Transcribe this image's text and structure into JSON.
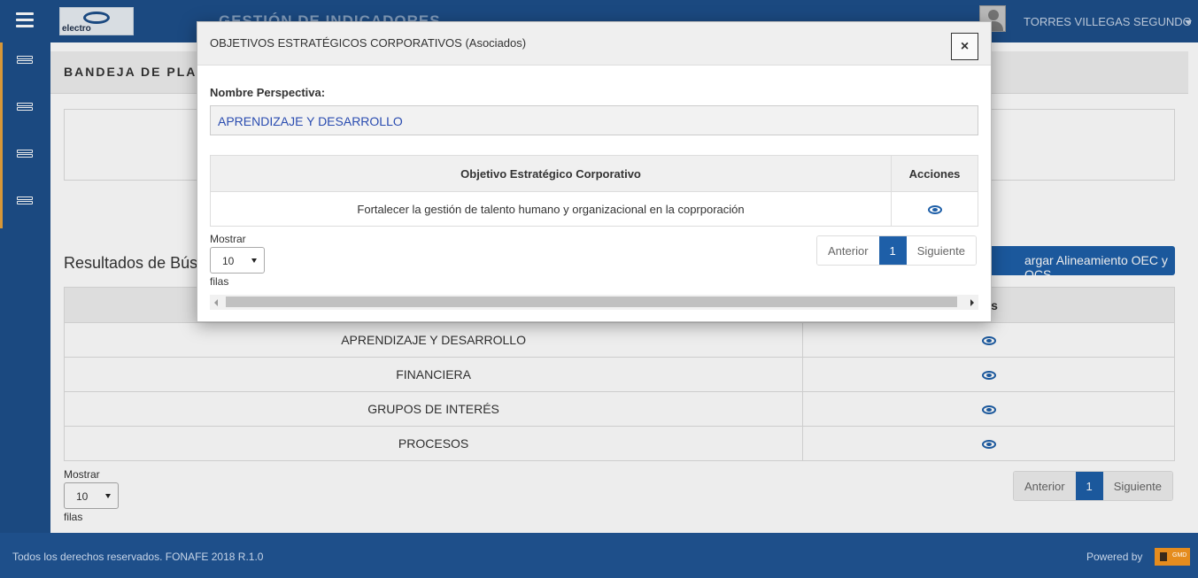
{
  "header": {
    "app_title": "GESTIÓN DE INDICADORES",
    "user_name": "TORRES VILLEGAS SEGUNDO",
    "logo_text": "electro"
  },
  "page": {
    "title": "BANDEJA DE PLA",
    "results_title": "Resultados de Bús",
    "align_button": "argar Alineamiento OEC y OCS",
    "table": {
      "actions_header": "ones",
      "rows": [
        "APRENDIZAJE Y DESARROLLO",
        "FINANCIERA",
        "GRUPOS DE INTERÉS",
        "PROCESOS"
      ]
    },
    "show_label": "Mostrar",
    "rows_value": "10",
    "rows_label": "filas",
    "pager": {
      "prev": "Anterior",
      "page": "1",
      "next": "Siguiente"
    }
  },
  "modal": {
    "title": "OBJETIVOS ESTRATÉGICOS CORPORATIVOS (Asociados)",
    "close": "×",
    "field_label": "Nombre Perspectiva:",
    "field_value": "APRENDIZAJE Y DESARROLLO",
    "table": {
      "col_objective": "Objetivo Estratégico Corporativo",
      "col_actions": "Acciones",
      "rows": [
        "Fortalecer la gestión de talento humano y organizacional en la coprporación"
      ]
    },
    "show_label": "Mostrar",
    "rows_value": "10",
    "rows_label": "filas",
    "pager": {
      "prev": "Anterior",
      "page": "1",
      "next": "Siguiente"
    }
  },
  "footer": {
    "copyright": "Todos los derechos reservados. FONAFE 2018 R.1.0",
    "powered_by": "Powered by",
    "brand": "GMD"
  },
  "colors": {
    "primary": "#1e4f8a",
    "accent": "#e8a33d",
    "button": "#1e5fa8"
  }
}
